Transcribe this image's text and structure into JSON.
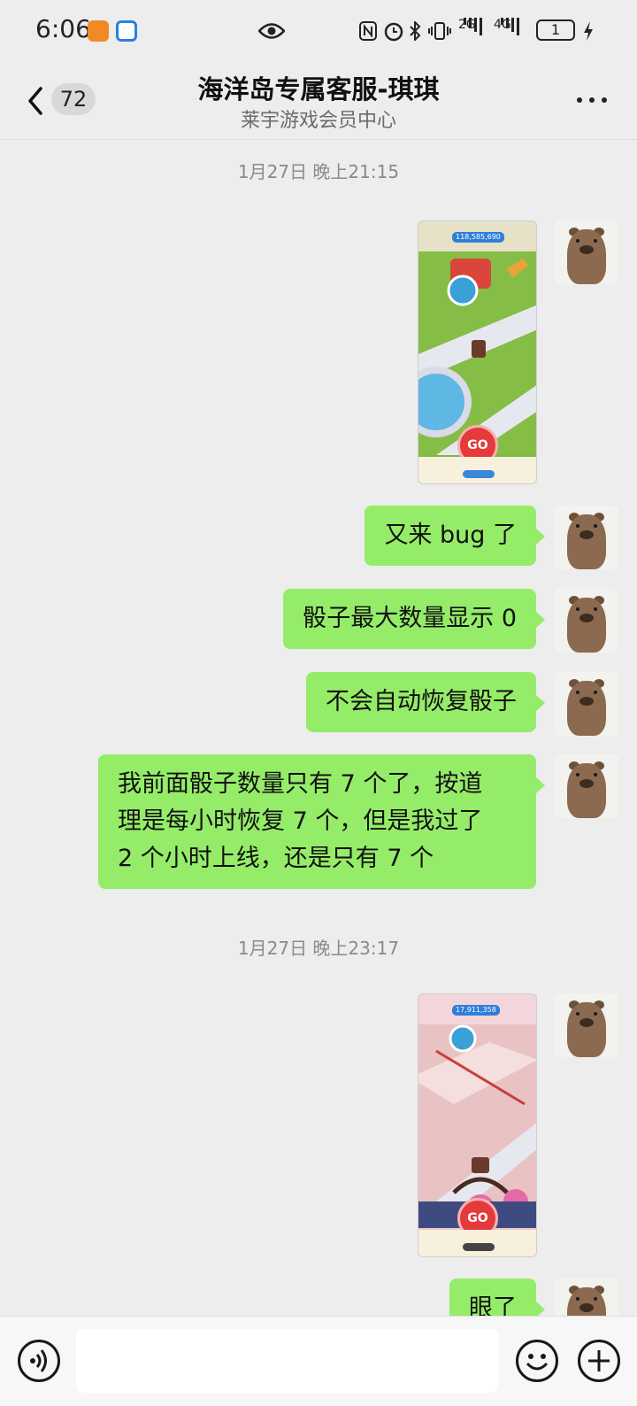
{
  "status_bar": {
    "time": "6:06",
    "network_2g": "2G",
    "network_4g": "4G",
    "battery_level": "1"
  },
  "header": {
    "back_badge": "72",
    "title": "海洋岛专属客服-琪琪",
    "subtitle": "莱宇游戏会员中心"
  },
  "chat": {
    "timestamps": [
      "1月27日 晚上21:15",
      "1月27日 晚上23:17"
    ],
    "messages": [
      {
        "kind": "image",
        "coins": "118,585,690"
      },
      {
        "kind": "text",
        "text": "又来 bug 了"
      },
      {
        "kind": "text",
        "text": "骰子最大数量显示 0"
      },
      {
        "kind": "text",
        "text": "不会自动恢复骰子"
      },
      {
        "kind": "text",
        "lines": [
          "我前面骰子数量只有 7 个了，按道",
          "理是每小时恢复 7 个，但是我过了",
          "2 个小时上线，还是只有 7 个"
        ]
      },
      {
        "kind": "image",
        "coins": "17,911,358"
      },
      {
        "kind": "text",
        "text": "眼了"
      }
    ],
    "image_go_label": "GO"
  },
  "input_bar": {
    "message_value": ""
  },
  "colors": {
    "background": "#ededed",
    "own_bubble": "#95ec69",
    "timestamp_text": "#8a8a8a"
  }
}
